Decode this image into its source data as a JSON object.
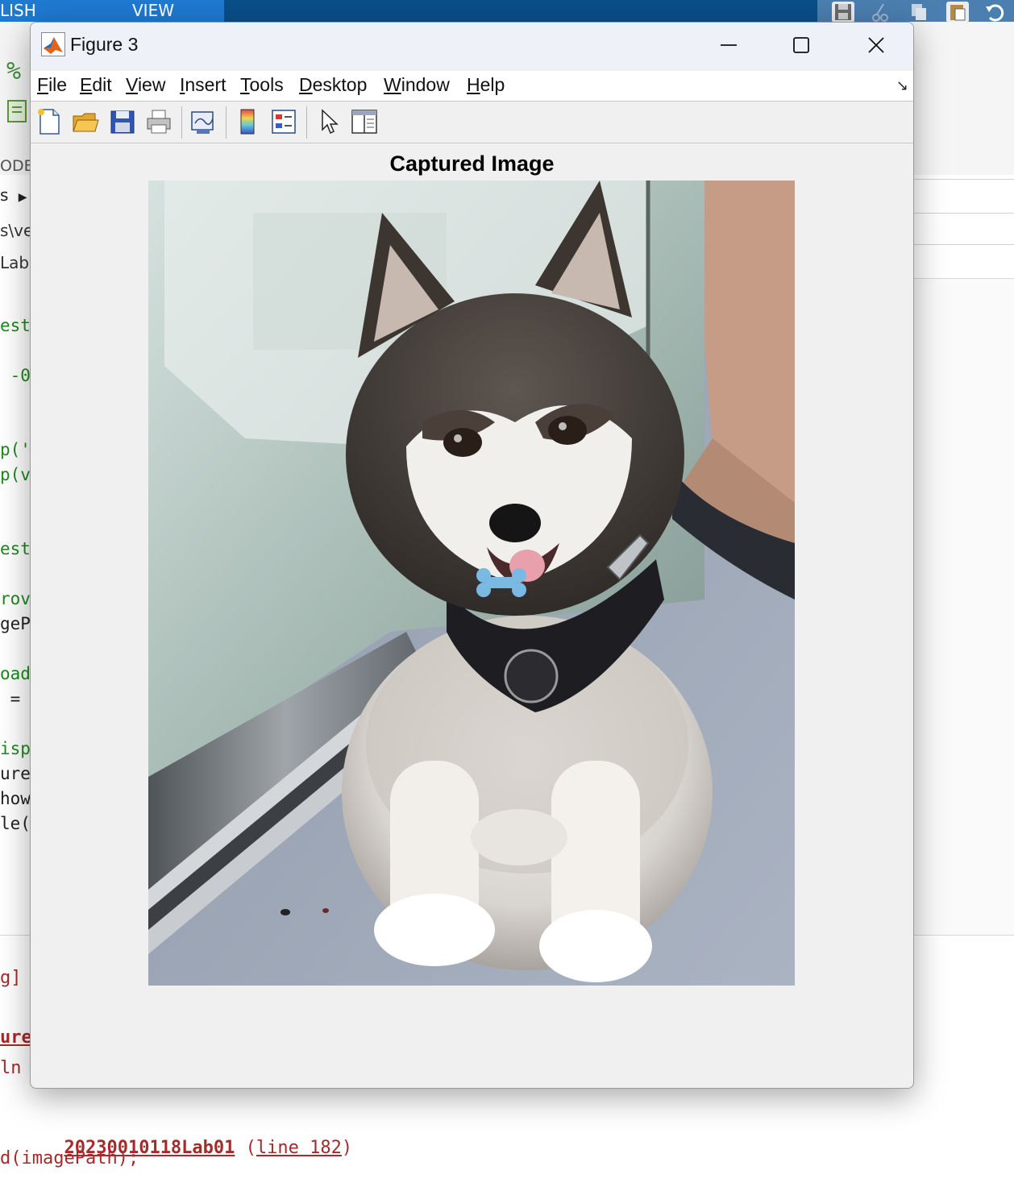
{
  "background": {
    "ribbon_tabs": [
      "LISH",
      "VIEW"
    ],
    "toolstrip_glyph": "%",
    "section_label": "ODE",
    "path_breadcrumb": "s",
    "path_fragment": "s\\ve",
    "file_fragment": "Lab(",
    "code_lines": [
      {
        "text": "est",
        "color": "green"
      },
      {
        "text": " -0",
        "color": "green"
      },
      {
        "text": "p('",
        "color": "green"
      },
      {
        "text": "p(v",
        "color": "green"
      },
      {
        "text": "est",
        "color": "green"
      },
      {
        "text": "rov",
        "color": "green"
      },
      {
        "text": "geP",
        "color": "black"
      },
      {
        "text": "oad",
        "color": "green"
      },
      {
        "text": " = ",
        "color": "black"
      },
      {
        "text": "isp",
        "color": "green"
      },
      {
        "text": "ure",
        "color": "black"
      },
      {
        "text": "how",
        "color": "black"
      },
      {
        "text": "le(",
        "color": "black"
      }
    ],
    "command_window": {
      "line1": "g]",
      "line2": "ure",
      "line3": "ln",
      "error_function": "20230010118Lab01",
      "error_line_link": "line 182",
      "error_code": "d(imagePath);"
    }
  },
  "figure_window": {
    "title": "Figure 3",
    "menu": [
      {
        "accel": "F",
        "rest": "ile"
      },
      {
        "accel": "E",
        "rest": "dit"
      },
      {
        "accel": "V",
        "rest": "iew"
      },
      {
        "accel": "I",
        "rest": "nsert"
      },
      {
        "accel": "T",
        "rest": "ools"
      },
      {
        "accel": "D",
        "rest": "esktop"
      },
      {
        "accel": "W",
        "rest": "indow"
      },
      {
        "accel": "H",
        "rest": "elp"
      }
    ],
    "toolbar_icons": [
      "new-figure-icon",
      "open-file-icon",
      "save-icon",
      "print-icon",
      "link-plot-icon",
      "insert-colorbar-icon",
      "insert-legend-icon",
      "edit-plot-icon",
      "property-inspector-icon"
    ],
    "axes_title": "Captured Image",
    "image_subject": "husky puppy wearing a black harness with a blue bone tag, sitting on a concrete floor next to a glass door"
  }
}
